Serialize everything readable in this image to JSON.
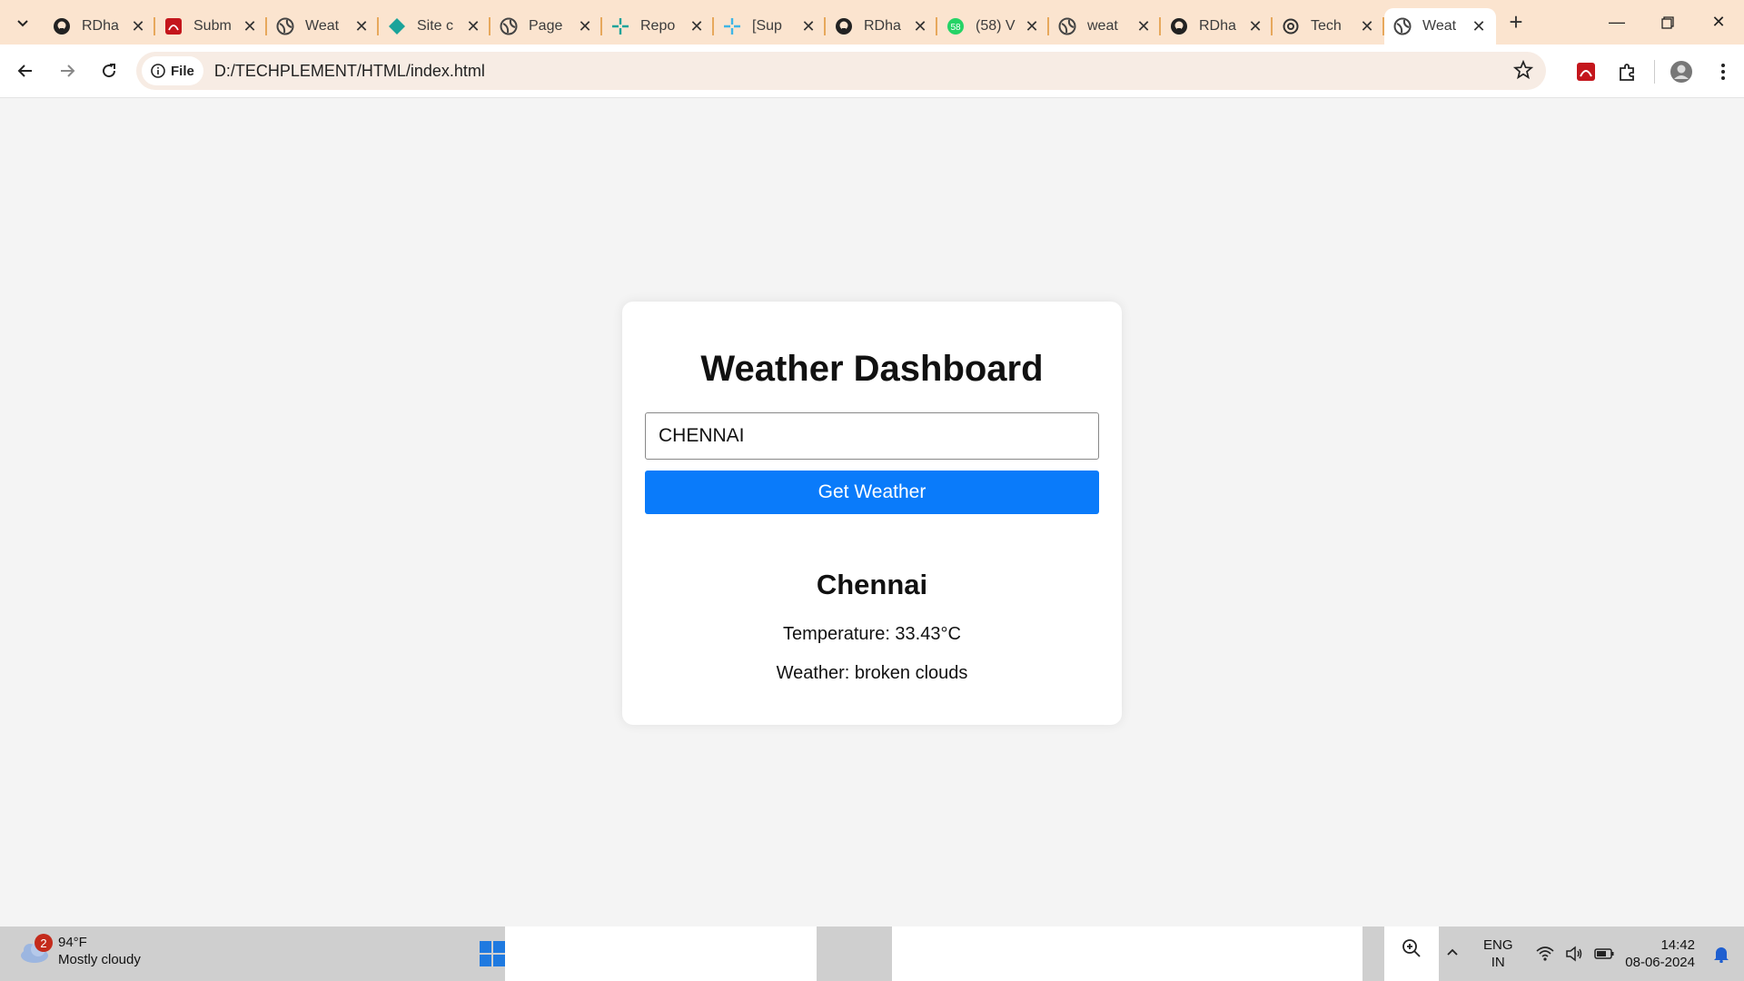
{
  "browser": {
    "tabs": [
      {
        "title": "RDha",
        "icon": "github-icon"
      },
      {
        "title": "Subm",
        "icon": "pdf-icon"
      },
      {
        "title": "Weat",
        "icon": "globe-icon"
      },
      {
        "title": "Site c",
        "icon": "diamond-icon"
      },
      {
        "title": "Page",
        "icon": "globe-icon"
      },
      {
        "title": "Repo",
        "icon": "sparkle-icon"
      },
      {
        "title": "[Sup",
        "icon": "sparkle-icon"
      },
      {
        "title": "RDha",
        "icon": "github-icon"
      },
      {
        "title": "(58) V",
        "icon": "whatsapp-icon"
      },
      {
        "title": "weat",
        "icon": "globe-icon"
      },
      {
        "title": "RDha",
        "icon": "github-icon"
      },
      {
        "title": "Tech",
        "icon": "openai-icon"
      },
      {
        "title": "Weat",
        "icon": "globe-icon",
        "active": true
      }
    ],
    "chip_label": "File",
    "url": "D:/TECHPLEMENT/HTML/index.html"
  },
  "page": {
    "heading": "Weather Dashboard",
    "city_input_value": "CHENNAI",
    "button_label": "Get Weather",
    "result": {
      "city": "Chennai",
      "temperature": "Temperature: 33.43°C",
      "weather": "Weather: broken clouds"
    }
  },
  "taskbar": {
    "weather_badge": "2",
    "weather_temp": "94°F",
    "weather_desc": "Mostly cloudy",
    "lang_line1": "ENG",
    "lang_line2": "IN",
    "time": "14:42",
    "date": "08-06-2024"
  },
  "colors": {
    "tabbar": "#fbe4cf",
    "page_bg": "#f4f4f4",
    "button": "#0a7bfa",
    "taskbar": "#cfcfcf"
  }
}
